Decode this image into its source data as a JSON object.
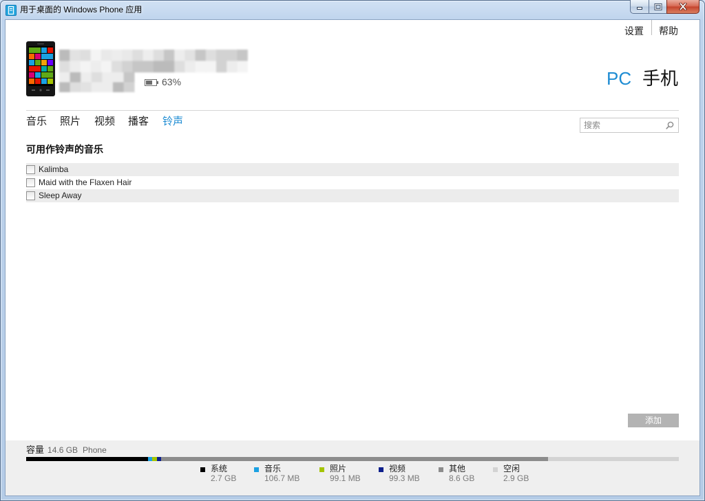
{
  "window": {
    "title": "用于桌面的 Windows Phone 应用"
  },
  "top_links": {
    "settings": "设置",
    "help": "帮助"
  },
  "device": {
    "battery": "63%"
  },
  "switcher": {
    "pc": "PC",
    "phone": "手机"
  },
  "tabs": [
    {
      "label": "音乐",
      "selected": false
    },
    {
      "label": "照片",
      "selected": false
    },
    {
      "label": "视频",
      "selected": false
    },
    {
      "label": "播客",
      "selected": false
    },
    {
      "label": "铃声",
      "selected": true
    }
  ],
  "search": {
    "placeholder": "搜索"
  },
  "ringtones": {
    "title": "可用作铃声的音乐",
    "songs": [
      {
        "title": "Kalimba",
        "checked": false
      },
      {
        "title": "Maid with the Flaxen Hair",
        "checked": false
      },
      {
        "title": "Sleep Away",
        "checked": false
      }
    ]
  },
  "add_button": {
    "label": "添加"
  },
  "capacity": {
    "label": "容量",
    "total": "14.6 GB",
    "device": "Phone",
    "segments": [
      {
        "label": "系统",
        "value": "2.7 GB",
        "color": "#000000"
      },
      {
        "label": "音乐",
        "value": "106.7 MB",
        "color": "#1ba1e2"
      },
      {
        "label": "照片",
        "value": "99.1 MB",
        "color": "#a4c400"
      },
      {
        "label": "视频",
        "value": "99.3 MB",
        "color": "#0d1f8c"
      },
      {
        "label": "其他",
        "value": "8.6 GB",
        "color": "#8c8c8c"
      },
      {
        "label": "空闲",
        "value": "2.9 GB",
        "color": "#d3d3d3"
      }
    ]
  },
  "colors": {
    "accent": "#1e8cd3",
    "row_alt": "#ececec",
    "add_button": "#b3b3b3",
    "footer": "#efefef"
  },
  "icons": {
    "app": "windows-phone-app-icon",
    "minimize": "minimize-icon",
    "maximize": "maximize-icon",
    "close": "close-icon",
    "device": "phone-image",
    "battery": "battery-icon",
    "search": "search-icon"
  }
}
